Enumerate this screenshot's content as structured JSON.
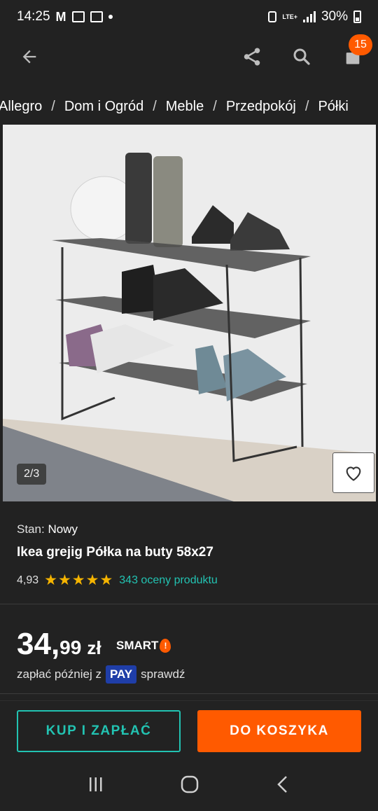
{
  "status_bar": {
    "time": "14:25",
    "battery": "30%",
    "network": "LTE+"
  },
  "app_bar": {
    "cart_count": "15"
  },
  "breadcrumb": {
    "items": [
      "Allegro",
      "Dom i Ogród",
      "Meble",
      "Przedpokój",
      "Półki"
    ],
    "separator": "/"
  },
  "gallery": {
    "counter": "2/3"
  },
  "product": {
    "condition_label": "Stan:",
    "condition_value": "Nowy",
    "title": "Ikea grejig Półka na buty 58x27",
    "rating_value": "4,93",
    "stars": "★★★★★",
    "rating_count": "343 oceny produktu"
  },
  "price": {
    "integer": "34,",
    "decimal": "99",
    "currency": "zł",
    "smart_label": "SMART"
  },
  "pay_later": {
    "prefix": "zapłać później z",
    "badge": "PAY",
    "suffix": "sprawdź"
  },
  "buttons": {
    "buy_now": "KUP I ZAPŁAĆ",
    "add_to_cart": "DO KOSZYKA"
  },
  "colors": {
    "accent_teal": "#22c3b2",
    "accent_orange": "#ff5a00",
    "background": "#222222",
    "star": "#f5b400",
    "pay_blue": "#1f3ea8"
  }
}
